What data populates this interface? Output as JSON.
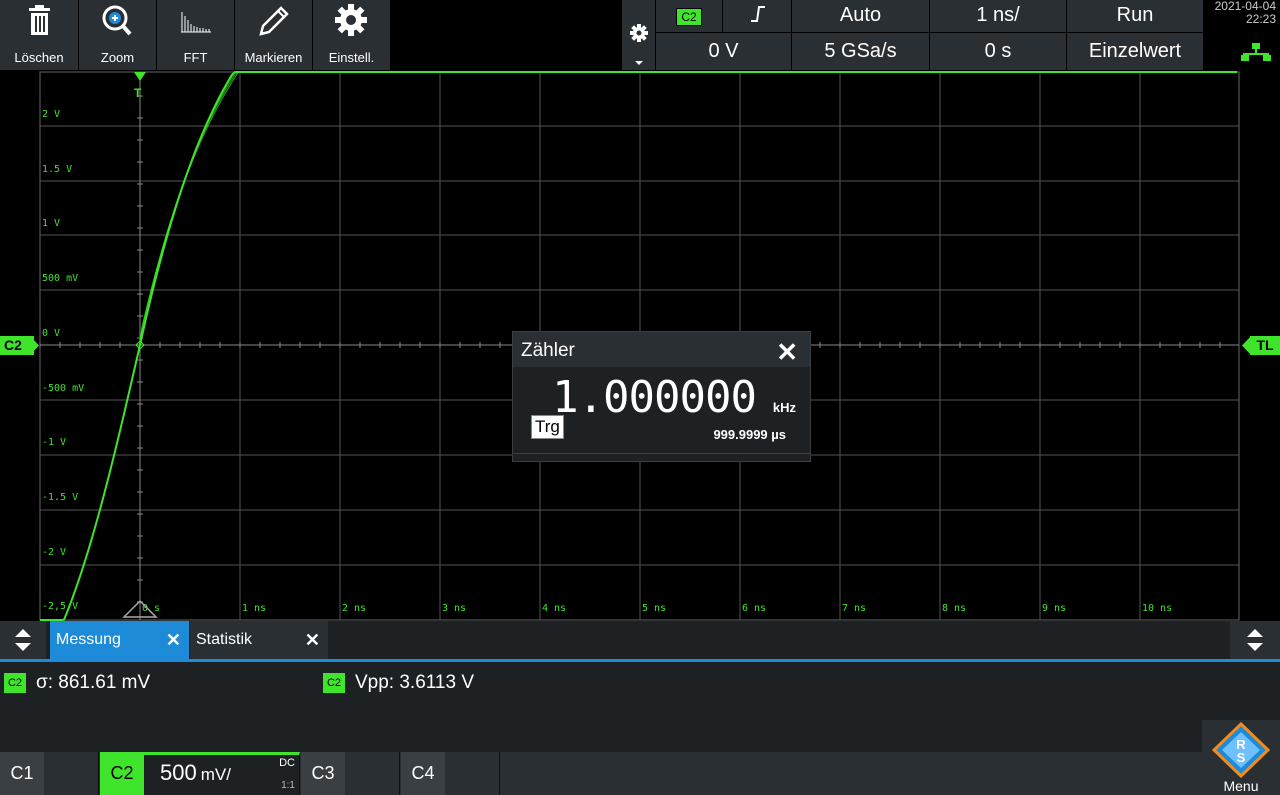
{
  "toolbar": {
    "buttons": [
      {
        "label": "Löschen",
        "icon": "trash-icon"
      },
      {
        "label": "Zoom",
        "icon": "zoom-icon"
      },
      {
        "label": "FFT",
        "icon": "fft-icon"
      },
      {
        "label": "Markieren",
        "icon": "pencil-icon"
      },
      {
        "label": "Einstell.",
        "icon": "gear-icon"
      }
    ]
  },
  "trigger": {
    "channel": "C2",
    "slope": "rising-edge-icon",
    "mode": "Auto",
    "level": "0 V"
  },
  "timebase": {
    "scale": "1 ns/",
    "sample_rate": "5 GSa/s",
    "position": "0 s"
  },
  "acquisition": {
    "state": "Run",
    "mode": "Einzelwert"
  },
  "datetime": {
    "date": "2021-04-04",
    "time": "22:23"
  },
  "plot": {
    "y_labels": [
      "2 V",
      "1.5 V",
      "1 V",
      "500 mV",
      "0 V",
      "-500 mV",
      "-1 V",
      "-1.5 V",
      "-2 V",
      "-2,5 V"
    ],
    "x_labels": [
      "0 s",
      "1 ns",
      "2 ns",
      "3 ns",
      "4 ns",
      "5 ns",
      "6 ns",
      "7 ns",
      "8 ns",
      "9 ns",
      "10 ns"
    ],
    "left_marker": "C2",
    "right_marker": "TL",
    "trigger_marker": "T",
    "trace_color": "#3fe52a"
  },
  "counter": {
    "title": "Zähler",
    "trigger_label": "Trg",
    "frequency": "1.000000",
    "frequency_unit": "kHz",
    "period": "999.9999 µs"
  },
  "tabs": [
    {
      "label": "Messung",
      "active": true
    },
    {
      "label": "Statistik",
      "active": false
    }
  ],
  "measurements": [
    {
      "channel": "C2",
      "label": "σ: 861.61 mV"
    },
    {
      "channel": "C2",
      "label": "Vpp: 3.6113 V"
    }
  ],
  "channels": [
    {
      "name": "C1"
    },
    {
      "name": "C2",
      "scale": "500",
      "unit": "mV/",
      "coupling": "DC",
      "ratio": "1:1"
    },
    {
      "name": "C3"
    },
    {
      "name": "C4"
    }
  ],
  "menu": {
    "label": "Menu"
  }
}
